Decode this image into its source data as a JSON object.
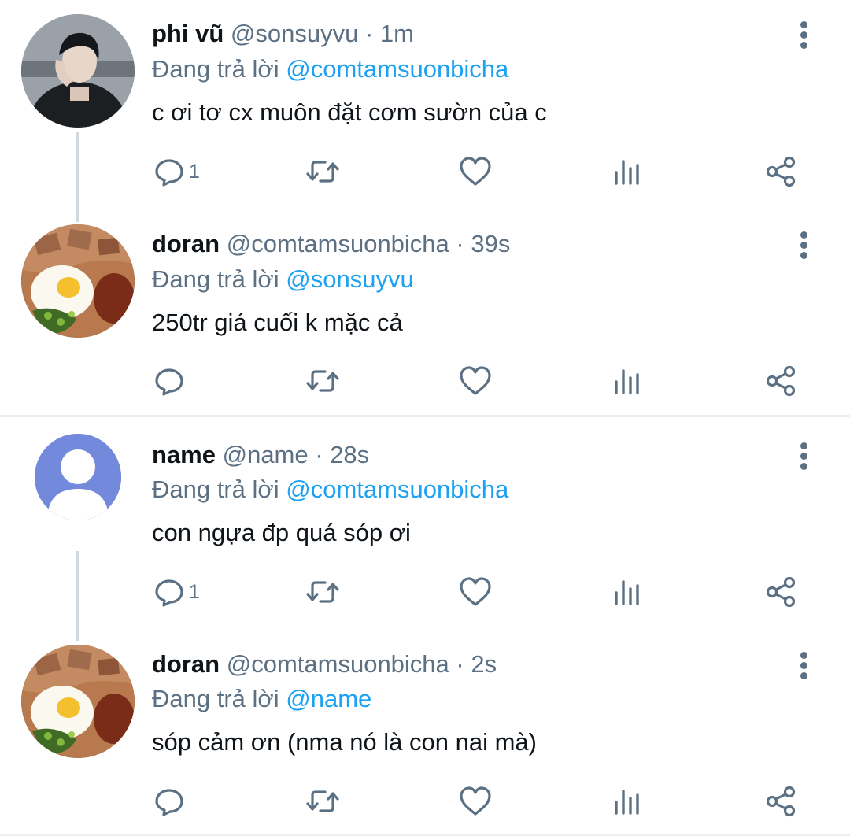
{
  "tweets": [
    {
      "name": "phi vũ",
      "handle": "@sonsuyvu",
      "time": "1m",
      "replying_label": "Đang trả lời",
      "replying_to": "@comtamsuonbicha",
      "text": "c ơi tơ cx muôn đặt cơm sườn của c",
      "reply_count": "1",
      "avatar": "person-photo"
    },
    {
      "name": "doran",
      "handle": "@comtamsuonbicha",
      "time": "39s",
      "replying_label": "Đang trả lời",
      "replying_to": "@sonsuyvu",
      "text": "250tr giá cuối k mặc cả",
      "reply_count": "",
      "avatar": "broken-rice-photo"
    },
    {
      "name": "name",
      "handle": "@name",
      "time": "28s",
      "replying_label": "Đang trả lời",
      "replying_to": "@comtamsuonbicha",
      "text": "con ngựa đp quá sóp ơi",
      "reply_count": "1",
      "avatar": "default-user"
    },
    {
      "name": "doran",
      "handle": "@comtamsuonbicha",
      "time": "2s",
      "replying_label": "Đang trả lời",
      "replying_to": "@name",
      "text": "sóp cảm ơn (nma nó là con nai mà)",
      "reply_count": "",
      "avatar": "broken-rice-photo"
    }
  ],
  "separator": " · ",
  "colors": {
    "mention": "#1da1f2",
    "secondary_text": "#5b7083",
    "thread_line": "#cfd9de",
    "icon": "#5b7083"
  },
  "icons": [
    "reply-icon",
    "retweet-icon",
    "like-icon",
    "analytics-icon",
    "share-icon",
    "more-options-icon"
  ]
}
